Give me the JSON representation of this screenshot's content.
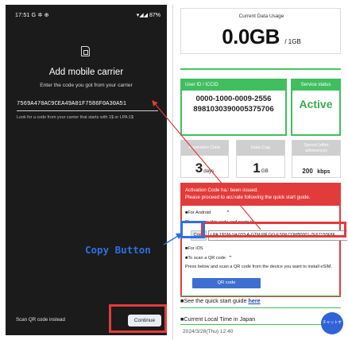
{
  "phone": {
    "status_time": "17:51 G ✲ ⊕",
    "status_right": "▾◢◢ 87%",
    "title": "Add mobile carrier",
    "subtitle": "Enter the code you got from your carrier",
    "code_value": "7569A470AC9CEA49A01F7586F0A30A51",
    "code_hint": "Look for a code from your carrier that starts with 1$ or LPA:1$",
    "scan_label": "Scan QR code instead",
    "continue_label": "Continue"
  },
  "web": {
    "usage_label": "Current Data Usage",
    "usage_value": "0.0GB",
    "usage_cap": "/ 1GB",
    "id_label": "User ID / ICCID",
    "id_line1": "0000-1000-0009-2556",
    "id_line2": "8981030390005375706",
    "status_label": "Service status",
    "status_value": "Active",
    "expiration_label": "Expiration Date",
    "expiration_value": "3",
    "expiration_unit": "days",
    "cap_label": "Data Cap",
    "cap_value": "1",
    "cap_unit": "GB",
    "speed_label": "Speed (after allowance)",
    "speed_value": "200",
    "speed_unit": "kbps",
    "act_line1": "Activation Code has been issued.",
    "act_line2": "Please proceed to activate following the quick start guide.",
    "android_label": "■For Android",
    "android_note": "Please copy this code and paste it.",
    "copy_label": "Copy",
    "act_code": "LPA:1$SM-V4-033-A-GTM.PR.GO-ESIM.COM$0001-7E67150F8E",
    "ios_label": "■For iOS",
    "qr_label": "■To scan a QR code",
    "qr_note": "Press below and scan a QR code from the device you want to install eSIM.",
    "qr_button": "QR code",
    "guide_prefix": "■See the quick start guide ",
    "guide_link": "here",
    "local_title": "■Current Local Time in Japan",
    "local_time": "2024/3/28(Thu) 12:40",
    "chat_label": "チャットする"
  },
  "annotation": {
    "callout": "Copy Button",
    "highlight_color": "#e23b3b",
    "callout_color": "#2f6fe0"
  }
}
